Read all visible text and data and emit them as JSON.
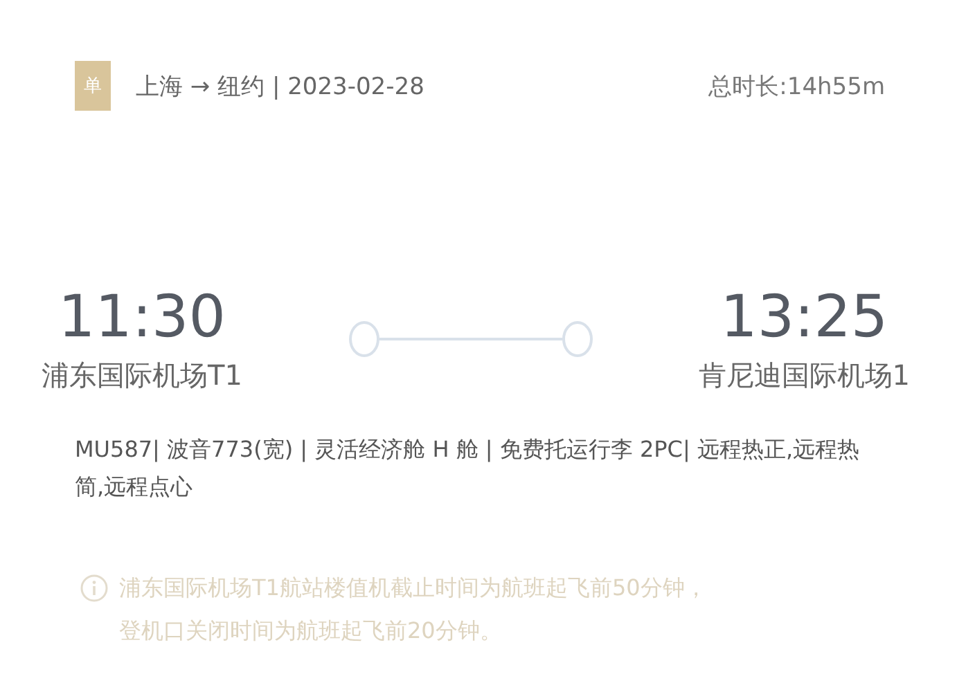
{
  "header": {
    "badge": "单",
    "route": "上海 → 纽约 | 2023-02-28",
    "duration": "总时长:14h55m"
  },
  "departure": {
    "time": "11:30",
    "airport": "浦东国际机场T1"
  },
  "arrival": {
    "time": "13:25",
    "airport": "肯尼迪国际机场1"
  },
  "details": "MU587| 波音773(宽) | 灵活经济舱 H 舱 | 免费托运行李 2PC| 远程热正,远程热简,远程点心",
  "notice": [
    "浦东国际机场T1航站楼值机截止时间为航班起飞前50分钟，",
    "登机口关闭时间为航班起飞前20分钟。"
  ]
}
